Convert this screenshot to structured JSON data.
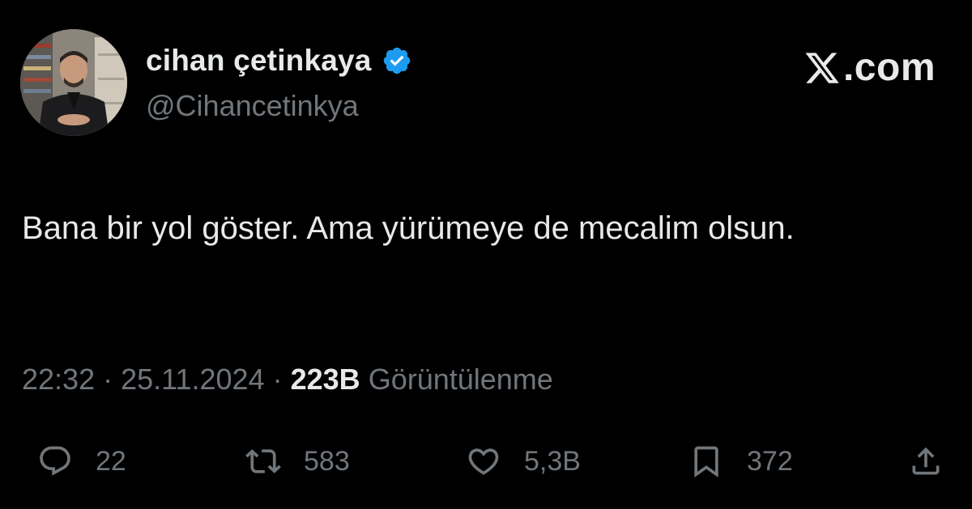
{
  "user": {
    "display_name": "cihan çetinkaya",
    "handle": "@Cihancetinkya",
    "avatar_icon": "profile-photo",
    "verified_color": "#1d9bf0"
  },
  "brand": {
    "suffix": ".com"
  },
  "tweet": {
    "text": "Bana bir yol göster. Ama yürümeye de mecalim olsun.",
    "time": "22:32",
    "date": "25.11.2024",
    "separator": " · ",
    "views_count": "223B",
    "views_label": "Görüntülenme"
  },
  "actions": {
    "replies": "22",
    "reposts": "583",
    "likes": "5,3B",
    "bookmarks": "372"
  },
  "colors": {
    "background": "#000000",
    "text": "#e7e9ea",
    "muted": "#71767b",
    "accent": "#1d9bf0"
  }
}
